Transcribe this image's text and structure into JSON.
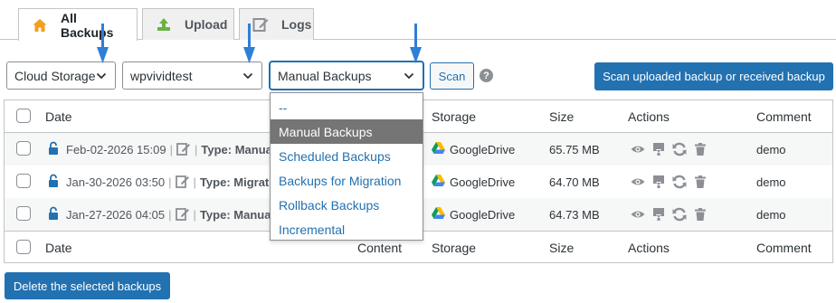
{
  "tabs": [
    {
      "label": "All Backups",
      "icon": "home-icon",
      "active": true
    },
    {
      "label": "Upload",
      "icon": "upload-icon",
      "active": false
    },
    {
      "label": "Logs",
      "icon": "edit-icon",
      "active": false
    }
  ],
  "filters": {
    "storage_select": "Cloud Storage",
    "site_select": "wpvividtest",
    "type_select": "Manual Backups",
    "scan_button": "Scan",
    "help": "?",
    "scan_uploaded_button": "Scan uploaded backup or received backup"
  },
  "type_options": [
    "--",
    "Manual Backups",
    "Scheduled Backups",
    "Backups for Migration",
    "Rollback Backups",
    "Incremental"
  ],
  "type_selected": "Manual Backups",
  "table": {
    "headers": {
      "date": "Date",
      "content": "Content",
      "storage": "Storage",
      "size": "Size",
      "actions": "Actions",
      "comment": "Comment"
    },
    "rows": [
      {
        "date": "Feb-02-2026 15:09",
        "type": "Type: Manual",
        "storage": "GoogleDrive",
        "size": "65.75 MB",
        "comment": "demo"
      },
      {
        "date": "Jan-30-2026 03:50",
        "type": "Type: Migration",
        "storage": "GoogleDrive",
        "size": "64.70 MB",
        "comment": "demo"
      },
      {
        "date": "Jan-27-2026 04:05",
        "type": "Type: Manual",
        "storage": "GoogleDrive",
        "size": "64.73 MB",
        "comment": "demo"
      }
    ]
  },
  "delete_button": "Delete the selected backups",
  "colors": {
    "accent": "#2271b1",
    "selected_option": "#757575",
    "border": "#c3c4c7"
  }
}
